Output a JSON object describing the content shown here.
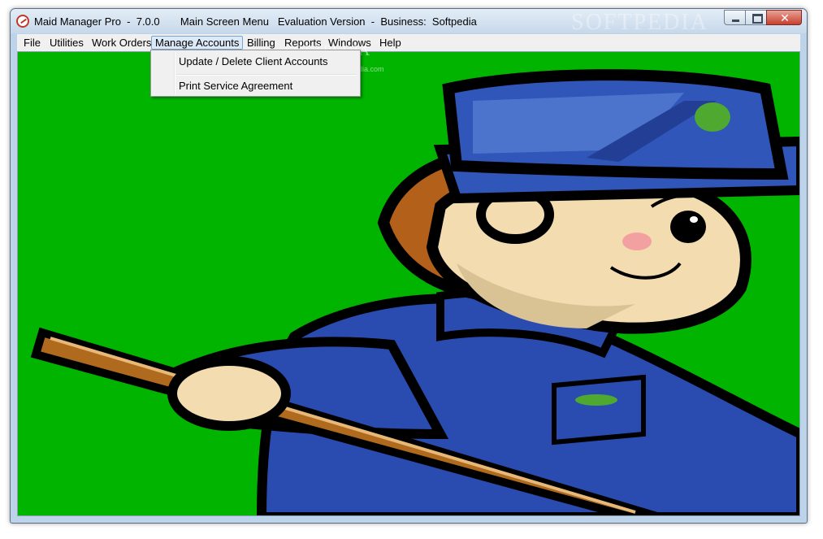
{
  "window": {
    "title": "Maid Manager Pro  -  7.0.0       Main Screen Menu   Evaluation Version  -  Business:  Softpedia",
    "title_watermark": "SOFTPEDIA",
    "buttons": {
      "minimize": "minimize",
      "maximize": "maximize",
      "close": "✕"
    }
  },
  "menubar": {
    "items": [
      {
        "label": "File"
      },
      {
        "label": "Utilities"
      },
      {
        "label": "Work Orders"
      },
      {
        "label": "Manage Accounts"
      },
      {
        "label": "Billing"
      },
      {
        "label": "Reports"
      },
      {
        "label": "Windows"
      },
      {
        "label": "Help"
      }
    ],
    "active": "Manage Accounts"
  },
  "dropdown": {
    "items": [
      {
        "label": "Update / Delete Client Accounts"
      },
      {
        "label": "Print Service Agreement"
      }
    ]
  },
  "watermark": {
    "text": "SOFTPEDIA",
    "sub": "www.softpedia.com"
  },
  "colors": {
    "background_green": "#00b400",
    "uniform_blue": "#2a4cb0",
    "hat_blue": "#2f56b8",
    "skin": "#f3dcb0",
    "hair": "#b2601a",
    "broom": "#b06a1e",
    "outline": "#000000"
  },
  "icons": [
    "app-icon",
    "minimize-icon",
    "maximize-icon",
    "close-icon"
  ]
}
